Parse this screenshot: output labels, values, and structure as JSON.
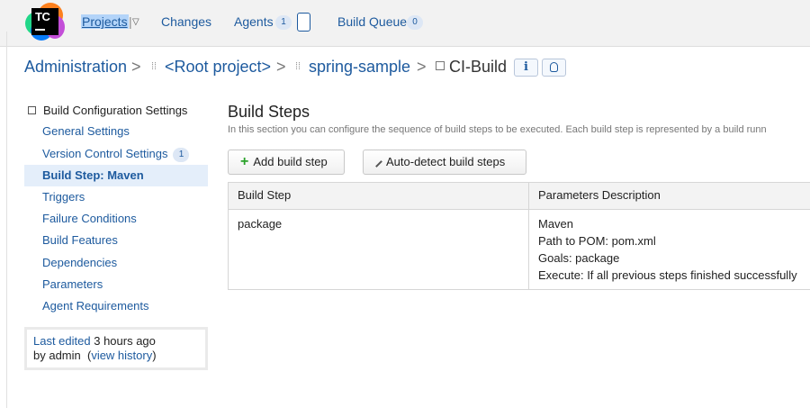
{
  "topnav": {
    "logo_text": "TC",
    "projects": "Projects",
    "changes": "Changes",
    "agents": "Agents",
    "agents_count": "1",
    "build_queue": "Build Queue",
    "queue_count": "0"
  },
  "breadcrumb": {
    "admin": "Administration",
    "root": "<Root project>",
    "spring": "spring-sample",
    "current": "CI-Build",
    "separator": ">"
  },
  "sidebar": {
    "title": "Build Configuration Settings",
    "items": [
      {
        "label": "General Settings"
      },
      {
        "label": "Version Control Settings",
        "badge": "1"
      },
      {
        "label": "Build Step: Maven"
      },
      {
        "label": "Triggers"
      },
      {
        "label": "Failure Conditions"
      },
      {
        "label": "Build Features"
      },
      {
        "label": "Dependencies"
      },
      {
        "label": "Parameters"
      },
      {
        "label": "Agent Requirements"
      }
    ],
    "last_edited_link": "Last edited",
    "last_edited_time": "3 hours ago",
    "by_user": "by admin",
    "view_history": "view history"
  },
  "main": {
    "title": "Build Steps",
    "description": "In this section you can configure the sequence of build steps to be executed. Each build step is represented by a build runn",
    "add_button": "Add build step",
    "autodetect_button": "Auto-detect build steps",
    "table": {
      "headers": [
        "Build Step",
        "Parameters Description"
      ],
      "rows": [
        {
          "step": "package",
          "params": [
            "Maven",
            "Path to POM: pom.xml",
            "Goals: package",
            "Execute: If all previous steps finished successfully"
          ]
        }
      ]
    }
  },
  "colors": {
    "link": "#1d5a9e",
    "active_bg": "#e4eefa",
    "topbar_bg": "#f2f2f2",
    "add_icon": "#2aa22a"
  }
}
